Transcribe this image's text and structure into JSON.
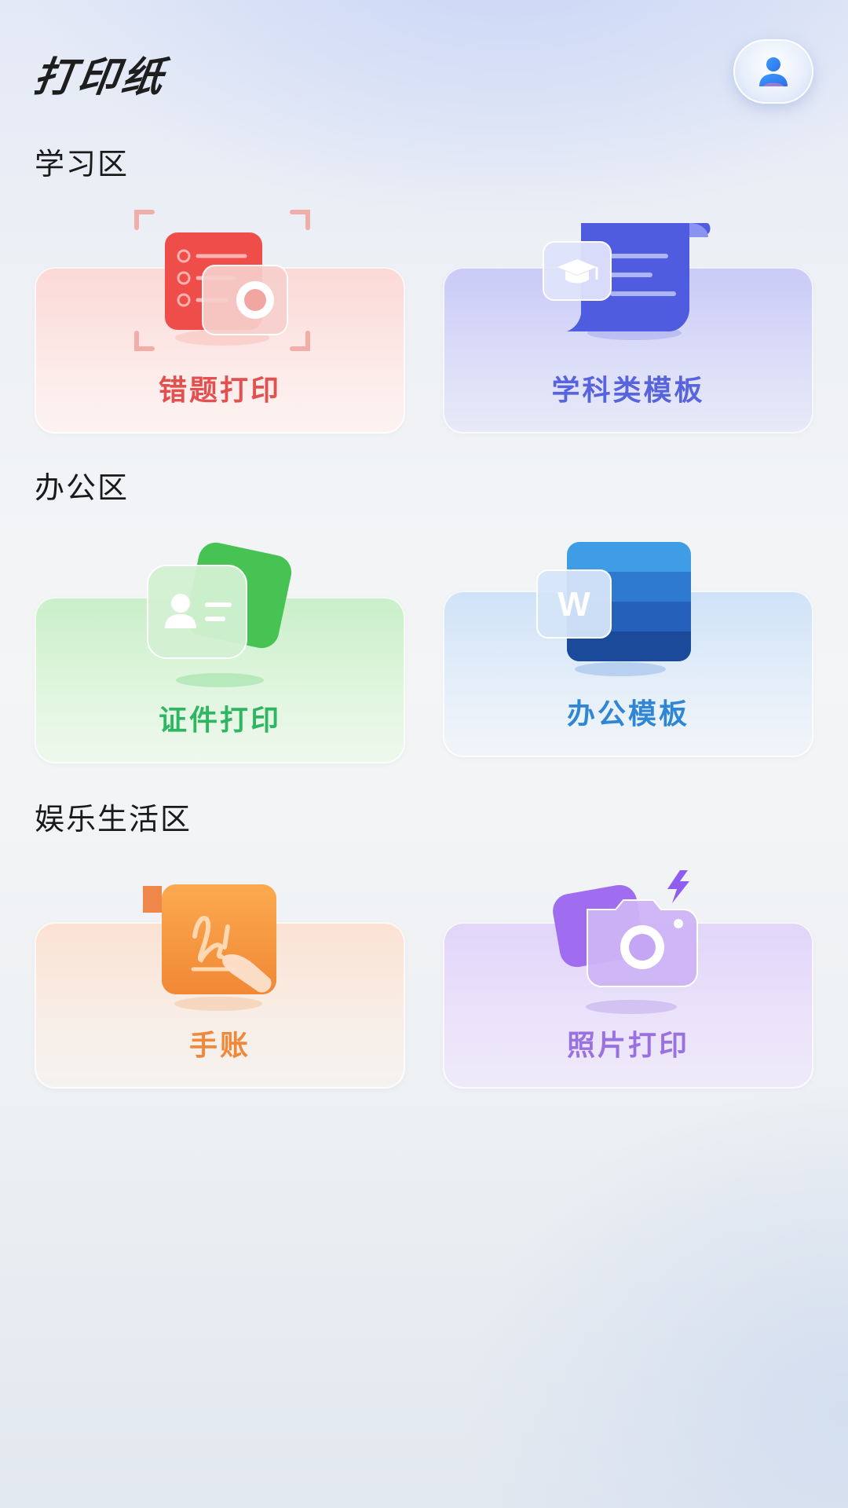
{
  "header": {
    "app_title": "打印纸",
    "profile_icon": "user-icon"
  },
  "sections": [
    {
      "title": "学习区",
      "cards": [
        {
          "label": "错题打印",
          "icon": "camera-scan-icon",
          "color": "#e2504f"
        },
        {
          "label": "学科类模板",
          "icon": "graduation-scroll-icon",
          "color": "#5863de"
        }
      ]
    },
    {
      "title": "办公区",
      "cards": [
        {
          "label": "证件打印",
          "icon": "id-card-icon",
          "color": "#2eb662"
        },
        {
          "label": "办公模板",
          "icon": "word-document-icon",
          "color": "#2f86d6"
        }
      ]
    },
    {
      "title": "娱乐生活区",
      "cards": [
        {
          "label": "手账",
          "icon": "journal-handwriting-icon",
          "color": "#f0883a"
        },
        {
          "label": "照片打印",
          "icon": "photo-camera-icon",
          "color": "#9a71e0"
        }
      ]
    }
  ]
}
